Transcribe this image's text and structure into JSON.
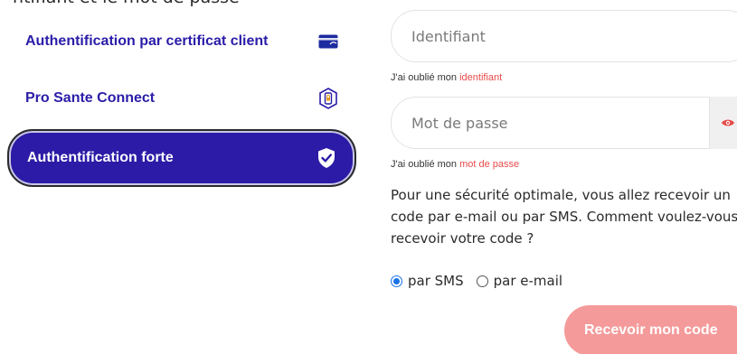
{
  "header": {
    "cut_text": "ntifiant et le mot de passe"
  },
  "methods": [
    {
      "label": "Authentification par certificat client",
      "icon": "card-icon"
    },
    {
      "label": "Pro Sante Connect",
      "icon": "phone-lock-icon"
    },
    {
      "label": "Authentification forte",
      "icon": "shield-check-icon",
      "active": true
    }
  ],
  "form": {
    "id_placeholder": "Identifiant",
    "forgot_id_prefix": "J'ai oublié mon ",
    "forgot_id_link": "identifiant",
    "pwd_placeholder": "Mot de passe",
    "forgot_pwd_prefix": "J'ai oublié mon ",
    "forgot_pwd_link": "mot de passe",
    "eye_icon": "eye-icon",
    "info": "Pour une sécurité optimale, vous allez recevoir un code par e-mail ou par SMS. Comment voulez-vous recevoir votre code ?",
    "choice_sms": "par SMS",
    "choice_email": "par e-mail",
    "selected": "sms",
    "submit_label": "Recevoir mon code"
  },
  "colors": {
    "brand": "#2c1ba6",
    "accent": "#e84a4a",
    "button": "#f49a9a",
    "radio": "#1a73e8"
  }
}
